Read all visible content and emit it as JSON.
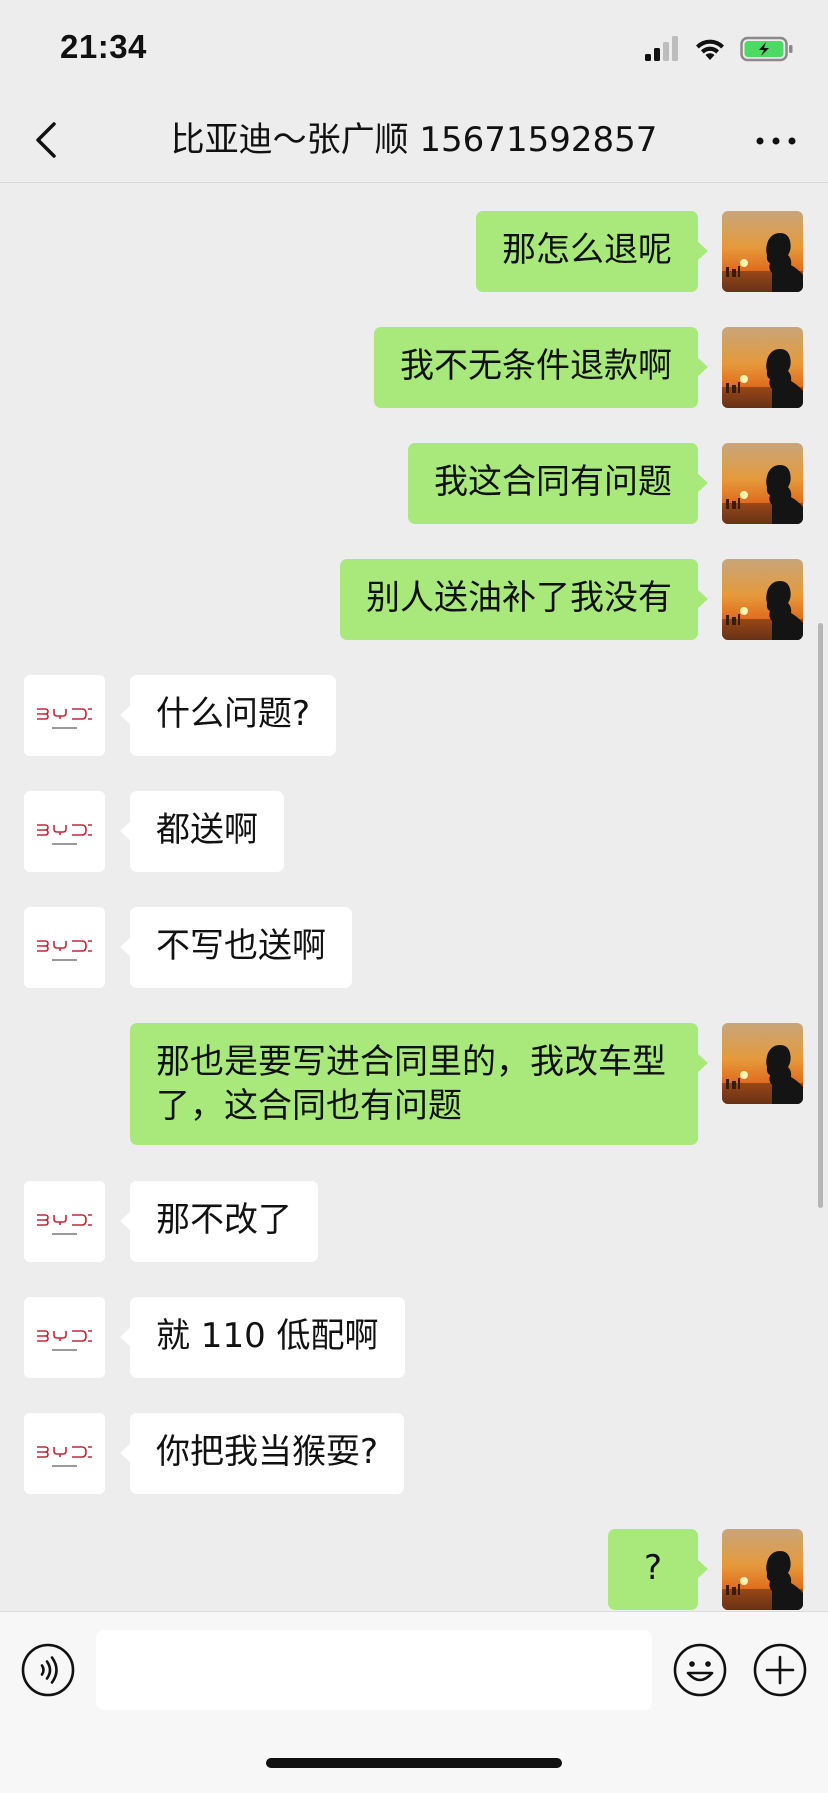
{
  "status_bar": {
    "time": "21:34"
  },
  "nav": {
    "title": "比亚迪～张广顺 15671592857"
  },
  "colors": {
    "my_bubble": "#a9e97c",
    "their_bubble": "#ffffff",
    "background": "#ededed",
    "byd_logo": "#c0283b"
  },
  "messages": [
    {
      "side": "me",
      "text": "那怎么退呢"
    },
    {
      "side": "me",
      "text": "我不无条件退款啊"
    },
    {
      "side": "me",
      "text": "我这合同有问题"
    },
    {
      "side": "me",
      "text": "别人送油补了我没有"
    },
    {
      "side": "them",
      "text": "什么问题?"
    },
    {
      "side": "them",
      "text": "都送啊"
    },
    {
      "side": "them",
      "text": "不写也送啊"
    },
    {
      "side": "me",
      "text": "那也是要写进合同里的，我改车型了，这合同也有问题"
    },
    {
      "side": "them",
      "text": "那不改了"
    },
    {
      "side": "them",
      "text": "就 110 低配啊"
    },
    {
      "side": "them",
      "text": "你把我当猴耍?"
    },
    {
      "side": "me",
      "text": "?"
    }
  ],
  "input_bar": {
    "placeholder": ""
  }
}
